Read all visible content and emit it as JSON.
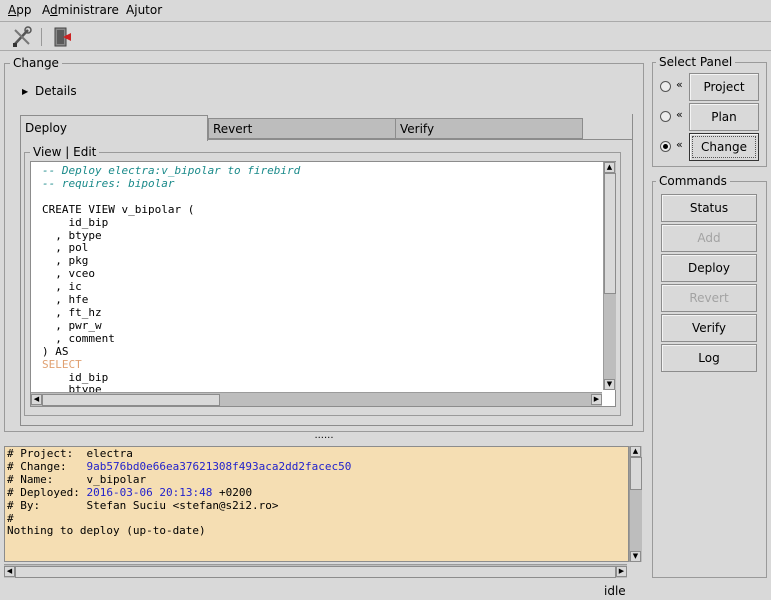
{
  "menubar": {
    "app": "App",
    "admin": "Administrare",
    "help": "Ajutor"
  },
  "toolbar": {
    "tools_icon": "tools-icon",
    "exit_icon": "exit-door-icon"
  },
  "change_frame": {
    "title": "Change",
    "details_label": "Details",
    "tabs": [
      "Deploy",
      "Revert",
      "Verify"
    ],
    "view_edit_title": "View | Edit",
    "code_lines": [
      {
        "text": "-- Deploy electra:v_bipolar to firebird",
        "color": "#1a8a8a",
        "italic": true
      },
      {
        "text": "-- requires: bipolar",
        "color": "#1a8a8a",
        "italic": true
      },
      {
        "text": "",
        "color": "#000000",
        "italic": false
      },
      {
        "text": "CREATE VIEW v_bipolar (",
        "color": "#000000",
        "italic": false
      },
      {
        "text": "    id_bip",
        "color": "#000000",
        "italic": false
      },
      {
        "text": "  , btype",
        "color": "#000000",
        "italic": false
      },
      {
        "text": "  , pol",
        "color": "#000000",
        "italic": false
      },
      {
        "text": "  , pkg",
        "color": "#000000",
        "italic": false
      },
      {
        "text": "  , vceo",
        "color": "#000000",
        "italic": false
      },
      {
        "text": "  , ic",
        "color": "#000000",
        "italic": false
      },
      {
        "text": "  , hfe",
        "color": "#000000",
        "italic": false
      },
      {
        "text": "  , ft_hz",
        "color": "#000000",
        "italic": false
      },
      {
        "text": "  , pwr_w",
        "color": "#000000",
        "italic": false
      },
      {
        "text": "  , comment",
        "color": "#000000",
        "italic": false
      },
      {
        "text": ") AS",
        "color": "#000000",
        "italic": false
      },
      {
        "text": "SELECT",
        "color": "#e0a070",
        "italic": false
      },
      {
        "text": "    id_bip",
        "color": "#000000",
        "italic": false
      },
      {
        "text": "    btype",
        "color": "#000000",
        "italic": false
      }
    ]
  },
  "splitter": {
    "grip": "......"
  },
  "log": {
    "lines": [
      [
        {
          "t": "# Project:  ",
          "c": "#000000"
        },
        {
          "t": "electra",
          "c": "#000000"
        }
      ],
      [
        {
          "t": "# Change:   ",
          "c": "#000000"
        },
        {
          "t": "9ab576bd0e66ea37621308f493aca2dd2facec50",
          "c": "#2222cc"
        }
      ],
      [
        {
          "t": "# Name:     ",
          "c": "#000000"
        },
        {
          "t": "v_bipolar",
          "c": "#000000"
        }
      ],
      [
        {
          "t": "# Deployed: ",
          "c": "#000000"
        },
        {
          "t": "2016-03-06 20:13:48",
          "c": "#2222cc"
        },
        {
          "t": " +0200",
          "c": "#000000"
        }
      ],
      [
        {
          "t": "# By:       ",
          "c": "#000000"
        },
        {
          "t": "Stefan Suciu <stefan@s2i2.ro>",
          "c": "#000000"
        }
      ],
      [
        {
          "t": "#",
          "c": "#000000"
        }
      ],
      [
        {
          "t": "Nothing to deploy (up-to-date)",
          "c": "#000000"
        }
      ]
    ]
  },
  "select_panel": {
    "title": "Select Panel",
    "marker": "«",
    "options": [
      {
        "label": "Project",
        "selected": false
      },
      {
        "label": "Plan",
        "selected": false
      },
      {
        "label": "Change",
        "selected": true
      }
    ]
  },
  "commands": {
    "title": "Commands",
    "buttons": [
      {
        "label": "Status",
        "enabled": true
      },
      {
        "label": "Add",
        "enabled": false
      },
      {
        "label": "Deploy",
        "enabled": true
      },
      {
        "label": "Revert",
        "enabled": false
      },
      {
        "label": "Verify",
        "enabled": true
      },
      {
        "label": "Log",
        "enabled": true
      }
    ]
  },
  "status": {
    "text": "idle"
  }
}
